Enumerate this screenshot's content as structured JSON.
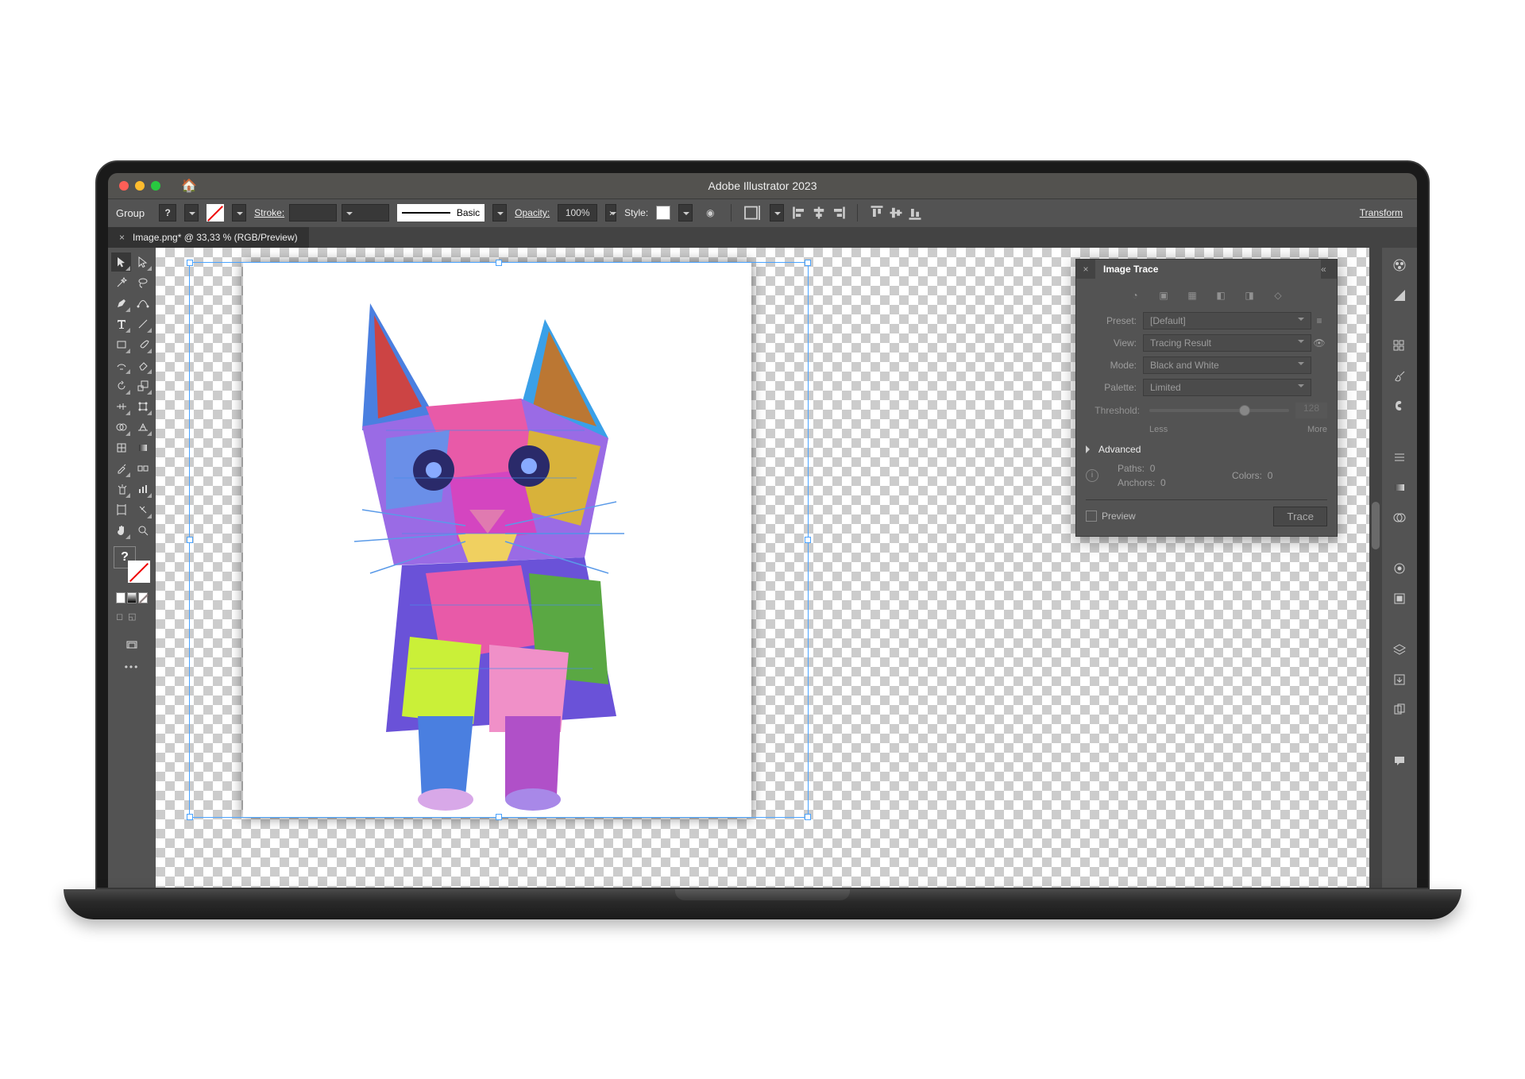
{
  "app": {
    "title": "Adobe Illustrator 2023"
  },
  "tab": {
    "label": "Image.png* @ 33,33 % (RGB/Preview)"
  },
  "options": {
    "group": "Group",
    "fill_unknown": "?",
    "stroke_label": "Stroke:",
    "brush_label": "Basic",
    "opacity_label": "Opacity:",
    "opacity_value": "100%",
    "style_label": "Style:",
    "transform": "Transform"
  },
  "image_trace": {
    "title": "Image Trace",
    "preset_label": "Preset:",
    "preset_value": "[Default]",
    "view_label": "View:",
    "view_value": "Tracing Result",
    "mode_label": "Mode:",
    "mode_value": "Black and White",
    "palette_label": "Palette:",
    "palette_value": "Limited",
    "threshold_label": "Threshold:",
    "threshold_value": "128",
    "less": "Less",
    "more": "More",
    "advanced": "Advanced",
    "paths_label": "Paths:",
    "paths_value": "0",
    "colors_label": "Colors:",
    "colors_value": "0",
    "anchors_label": "Anchors:",
    "anchors_value": "0",
    "preview": "Preview",
    "trace": "Trace"
  },
  "tools": {
    "artboards_btn": "⊞"
  }
}
